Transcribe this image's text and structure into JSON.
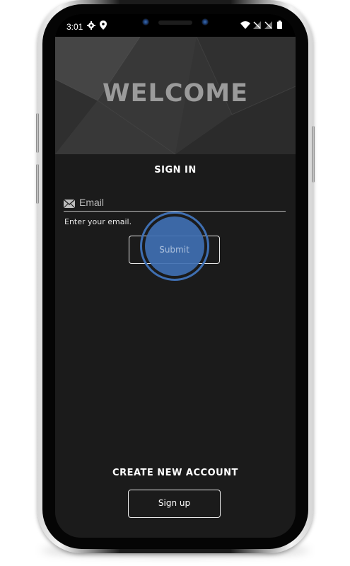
{
  "status_bar": {
    "time": "3:01",
    "left_icons": [
      "gear-icon",
      "location-pin-icon"
    ],
    "right_icons": [
      "wifi-icon",
      "signal-off-icon",
      "signal-off-icon",
      "battery-icon"
    ]
  },
  "header": {
    "title": "WELCOME"
  },
  "sign_in": {
    "title": "SIGN IN",
    "email_placeholder": "Email",
    "email_value": "",
    "helper_text": "Enter your email.",
    "submit_label": "Submit"
  },
  "create_account": {
    "title": "CREATE NEW ACCOUNT",
    "signup_label": "Sign up"
  },
  "colors": {
    "background": "#1b1b1b",
    "header_bg": "#3a3a3a",
    "touch_indicator": "#3f6fb2",
    "text": "#ffffff"
  }
}
